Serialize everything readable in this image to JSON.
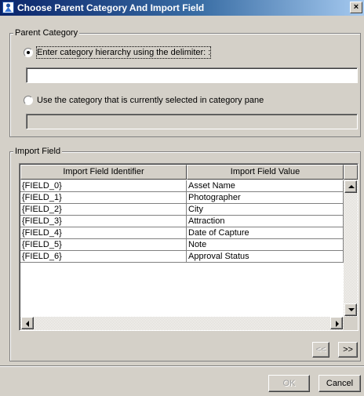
{
  "window": {
    "title": "Choose Parent Category And Import Field",
    "close_glyph": "×"
  },
  "parent_category": {
    "legend": "Parent Category",
    "option_delimiter": {
      "label": "Enter category hierarchy using the delimiter: :",
      "selected": true
    },
    "delimiter_input_value": "",
    "option_current": {
      "label": "Use the category that is currently selected in category pane",
      "selected": false
    },
    "current_category_value": ""
  },
  "import_field": {
    "legend": "Import Field",
    "columns": [
      "Import Field Identifier",
      "Import Field Value"
    ],
    "rows": [
      {
        "identifier": "{FIELD_0}",
        "value": "Asset Name"
      },
      {
        "identifier": "{FIELD_1}",
        "value": "Photographer"
      },
      {
        "identifier": "{FIELD_2}",
        "value": "City"
      },
      {
        "identifier": "{FIELD_3}",
        "value": "Attraction"
      },
      {
        "identifier": "{FIELD_4}",
        "value": "Date of Capture"
      },
      {
        "identifier": "{FIELD_5}",
        "value": "Note"
      },
      {
        "identifier": "{FIELD_6}",
        "value": "Approval Status"
      }
    ],
    "prev_button": "<<",
    "next_button": ">>"
  },
  "buttons": {
    "ok": "OK",
    "cancel": "Cancel"
  },
  "colors": {
    "dialog_bg": "#d4d0c8",
    "title_start": "#0a246a",
    "title_end": "#a6caf0"
  }
}
